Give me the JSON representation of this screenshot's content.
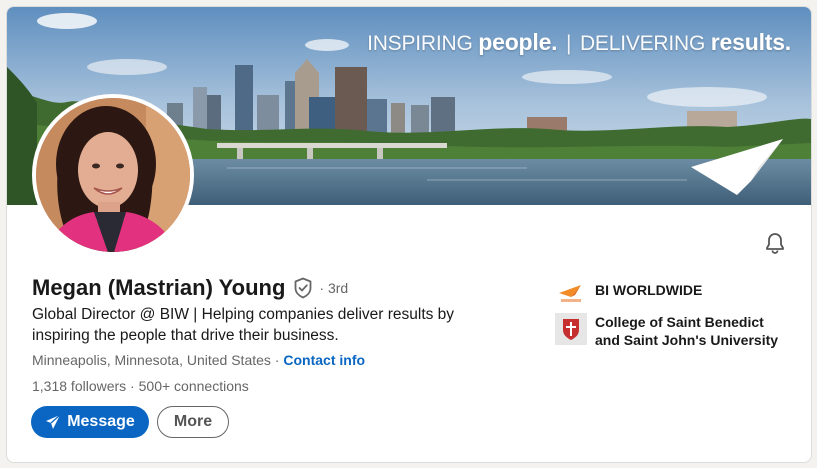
{
  "banner": {
    "tagline_word1": "INSPIRING",
    "tagline_word2": "people.",
    "tagline_separator": "|",
    "tagline_word3": "DELIVERING",
    "tagline_word4": "results."
  },
  "profile": {
    "name": "Megan (Mastrian) Young",
    "degree": "· 3rd",
    "headline": "Global Director @ BIW | Helping companies deliver results by inspiring the people that drive their business.",
    "location": "Minneapolis, Minnesota, United States",
    "location_separator": " · ",
    "contact_link": "Contact info",
    "followers": "1,318 followers",
    "stats_separator": " · ",
    "connections": "500+ connections"
  },
  "actions": {
    "message_label": "Message",
    "more_label": "More"
  },
  "organizations": [
    {
      "name": "BI WORLDWIDE",
      "icon": "bi-worldwide-logo"
    },
    {
      "name": "College of Saint Benedict and Saint John's University",
      "icon": "csb-sju-logo"
    }
  ],
  "icons": {
    "notification": "bell-icon",
    "verified": "verified-shield-icon",
    "message": "paper-plane-icon"
  },
  "colors": {
    "accent": "#0a66c2",
    "text_primary": "#191919",
    "text_secondary": "#666666"
  }
}
